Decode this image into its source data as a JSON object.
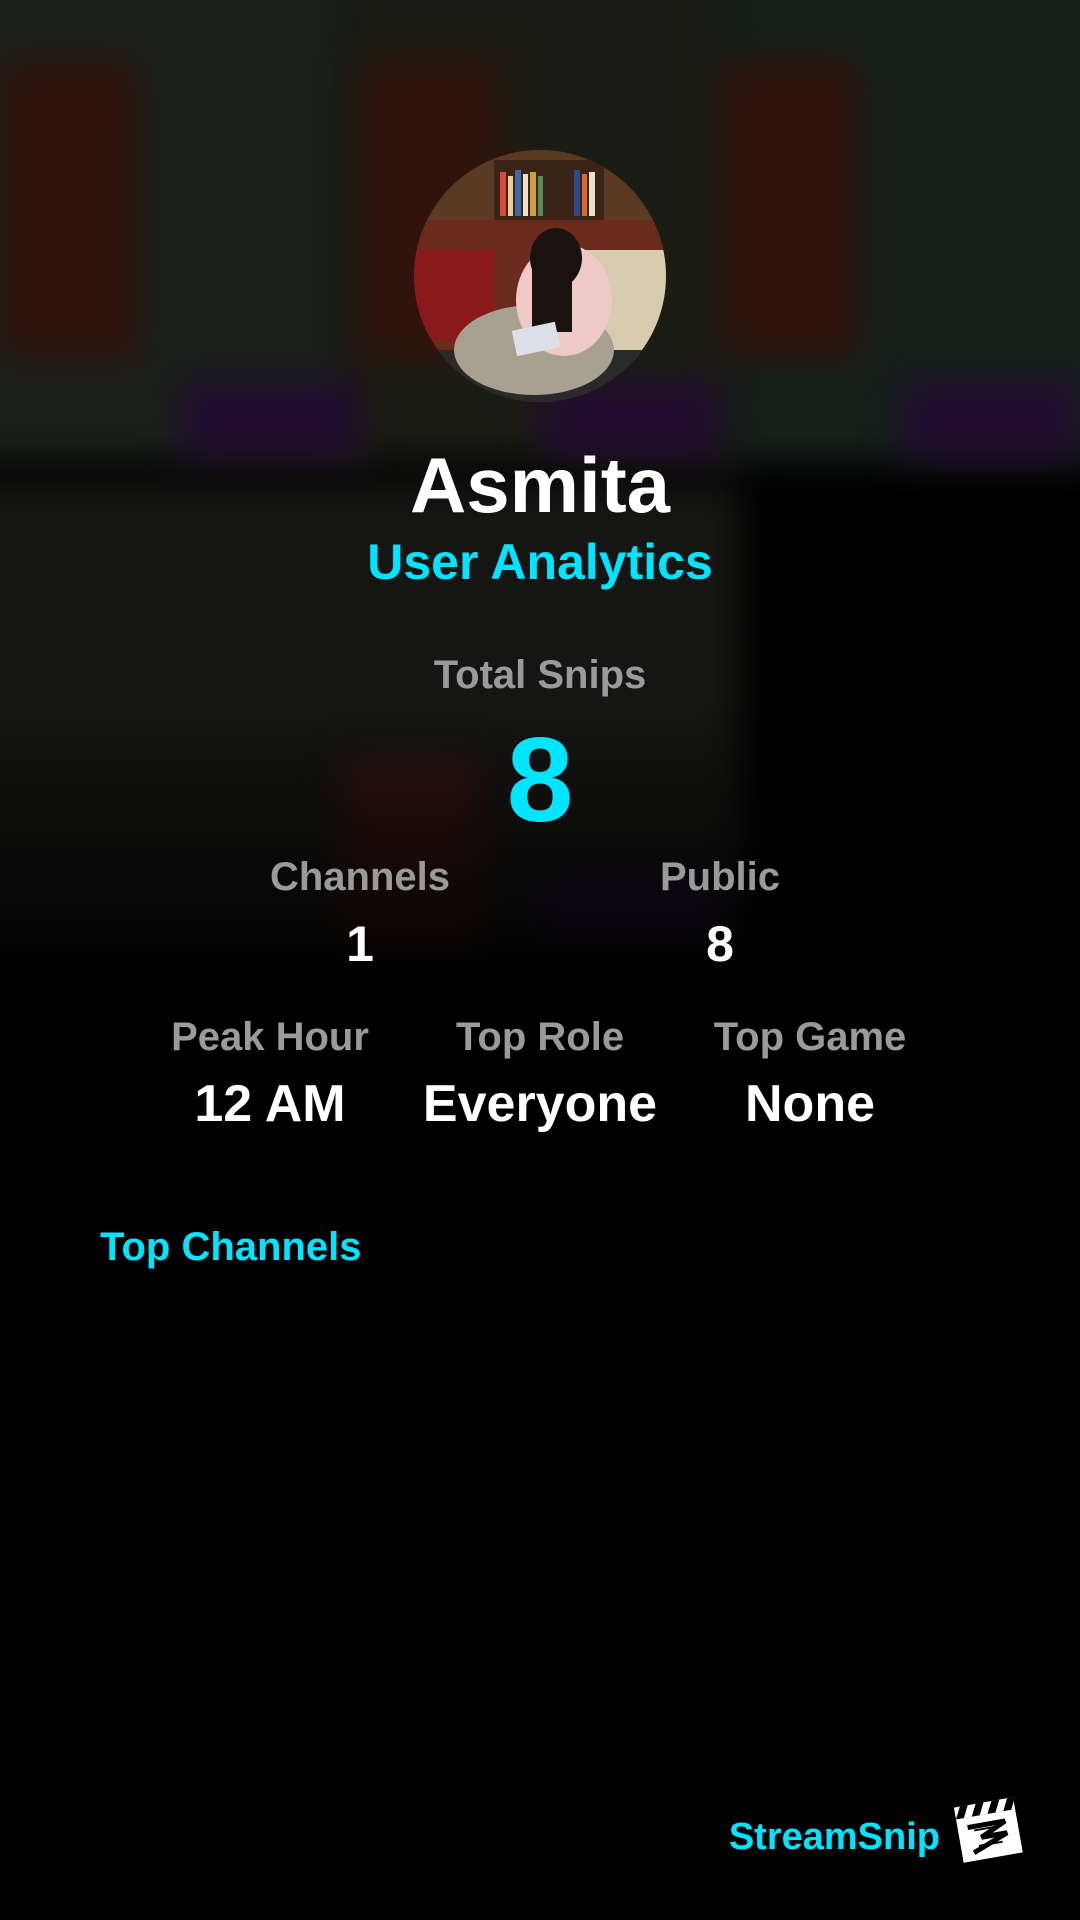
{
  "accent_color": "#00e5ff",
  "profile": {
    "name": "Asmita",
    "subtitle": "User Analytics",
    "avatar_icon": "profile-photo"
  },
  "stats": {
    "total_snips": {
      "label": "Total Snips",
      "value": "8"
    },
    "channels": {
      "label": "Channels",
      "value": "1"
    },
    "public": {
      "label": "Public",
      "value": "8"
    },
    "peak_hour": {
      "label": "Peak Hour",
      "value": "12 AM"
    },
    "top_role": {
      "label": "Top Role",
      "value": "Everyone"
    },
    "top_game": {
      "label": "Top Game",
      "value": "None"
    }
  },
  "sections": {
    "top_channels_title": "Top Channels"
  },
  "branding": {
    "name": "StreamSnip",
    "logo_icon": "clapperboard-icon"
  }
}
